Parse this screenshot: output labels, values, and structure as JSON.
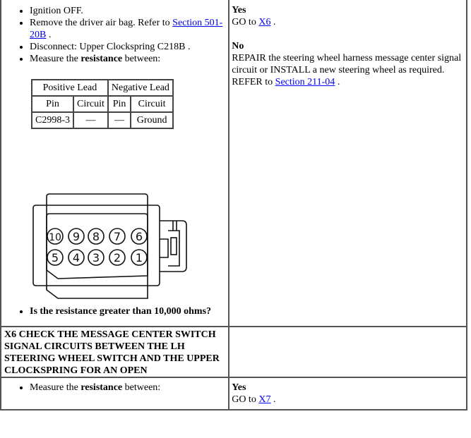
{
  "step_x5": {
    "instructions": [
      {
        "text": "Ignition OFF."
      },
      {
        "text": "Remove the driver air bag. Refer to ",
        "link": "Section 501-20B",
        "after": " ."
      },
      {
        "text": "Disconnect: Upper Clockspring C218B ."
      },
      {
        "pre": "Measure the ",
        "bold": "resistance",
        "post": " between:"
      }
    ],
    "measurement_table": {
      "group_headers": [
        "Positive Lead",
        "Negative Lead"
      ],
      "column_headers": [
        "Pin",
        "Circuit",
        "Pin",
        "Circuit"
      ],
      "rows": [
        [
          "C2998-3",
          "—",
          "—",
          "Ground"
        ]
      ]
    },
    "connector": {
      "name": "connector-pinout",
      "top_row_pins": [
        "10",
        "9",
        "8",
        "7",
        "6"
      ],
      "bottom_row_pins": [
        "5",
        "4",
        "3",
        "2",
        "1"
      ]
    },
    "question": "Is the resistance greater than 10,000 ohms?",
    "yes_label": "Yes",
    "yes_text": "GO to ",
    "yes_link": "X6",
    "yes_after": " .",
    "no_label": "No",
    "no_text": "REPAIR the steering wheel harness message center signal circuit or INSTALL a new steering wheel as required. REFER to ",
    "no_link": "Section 211-04",
    "no_after": " ."
  },
  "step_x6": {
    "heading": "X6 CHECK THE MESSAGE CENTER SWITCH SIGNAL CIRCUITS BETWEEN THE LH STEERING WHEEL SWITCH AND THE UPPER CLOCKSPRING FOR AN OPEN",
    "instruction_pre": "Measure the ",
    "instruction_bold": "resistance",
    "instruction_post": " between:",
    "yes_label": "Yes",
    "yes_text": "GO to ",
    "yes_link": "X7",
    "yes_after": " ."
  }
}
